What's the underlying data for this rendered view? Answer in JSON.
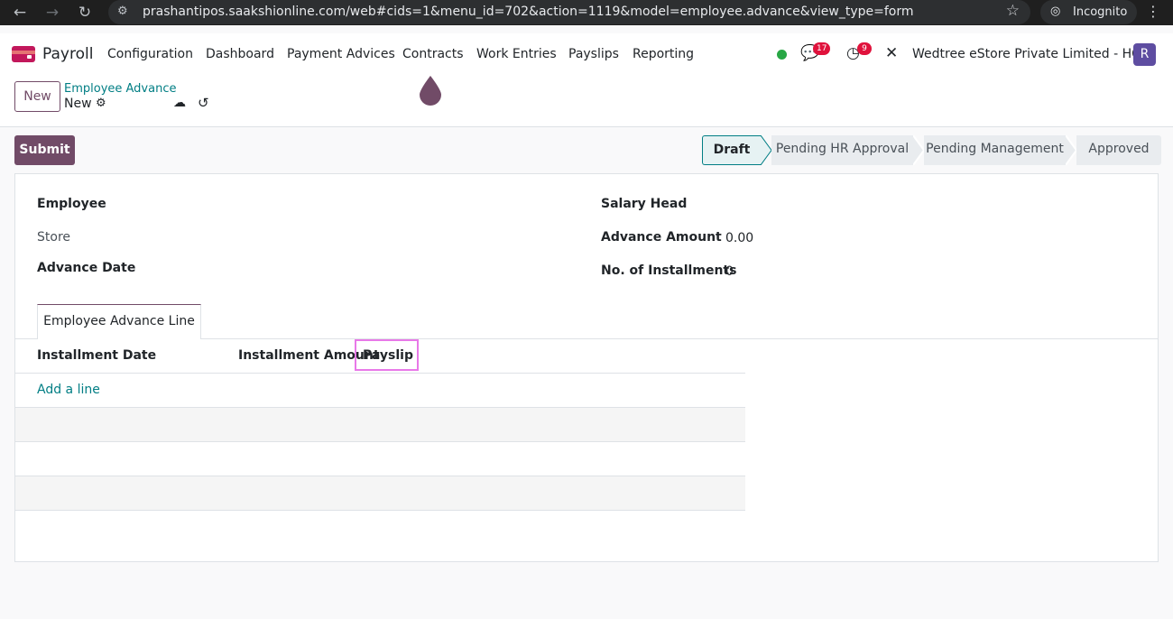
{
  "browser": {
    "url": "prashantipos.saakshionline.com/web#cids=1&menu_id=702&action=1119&model=employee.advance&view_type=form",
    "incognito_label": "Incognito"
  },
  "navbar": {
    "app_name": "Payroll",
    "menu": [
      "Configuration",
      "Dashboard",
      "Payment Advices",
      "Contracts",
      "Work Entries",
      "Payslips",
      "Reporting"
    ],
    "messages_count": "17",
    "activities_count": "9",
    "company": "Wedtree eStore Private Limited - HO",
    "avatar_initial": "R",
    "colors": {
      "brand": "#714b67",
      "badge": "#e0123c",
      "presence": "#28a745"
    }
  },
  "control_panel": {
    "new_button": "New",
    "breadcrumb_parent": "Employee Advance",
    "breadcrumb_current": "New"
  },
  "status": {
    "submit_button": "Submit",
    "stages": [
      "Draft",
      "Pending HR Approval",
      "Pending Management",
      "Approved"
    ],
    "current": "Draft"
  },
  "form": {
    "employee_label": "Employee",
    "store_label": "Store",
    "advance_date_label": "Advance Date",
    "salary_head_label": "Salary Head",
    "advance_amount_label": "Advance Amount",
    "advance_amount_value": "0.00",
    "installments_label": "No. of Installments",
    "installments_value": "0"
  },
  "notebook": {
    "tab_label": "Employee Advance Line",
    "columns": [
      "Installment Date",
      "Installment Amount",
      "Payslip"
    ],
    "add_line": "Add a line"
  }
}
